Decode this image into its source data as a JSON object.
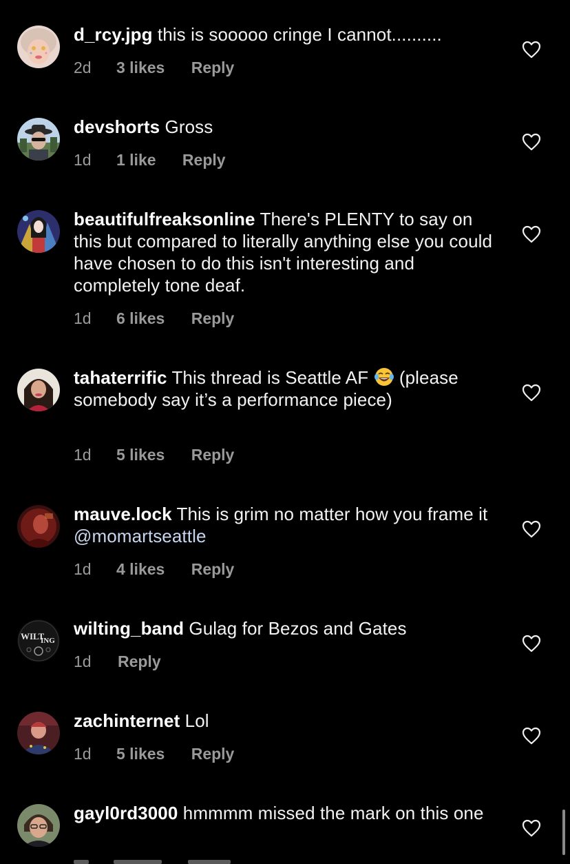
{
  "comments": [
    {
      "username": "d_rcy.jpg",
      "text": "this is sooooo cringe I cannot..........",
      "time": "2d",
      "likes": "3 likes",
      "reply": "Reply"
    },
    {
      "username": "devshorts",
      "text": "Gross",
      "time": "1d",
      "likes": "1 like",
      "reply": "Reply"
    },
    {
      "username": "beautifulfreaksonline",
      "text": "There's PLENTY to say on this but compared to literally anything else you could have chosen to do this isn't interesting and completely tone deaf.",
      "time": "1d",
      "likes": "6 likes",
      "reply": "Reply"
    },
    {
      "username": "tahaterrific",
      "text_before_emoji": "This thread is Seattle AF",
      "text_after_emoji": "(please somebody say it’s a performance piece)",
      "time": "1d",
      "likes": "5 likes",
      "reply": "Reply"
    },
    {
      "username": "mauve.lock",
      "text": "This is grim no matter how you frame it",
      "mention": "@momartseattle",
      "time": "1d",
      "likes": "4 likes",
      "reply": "Reply"
    },
    {
      "username": "wilting_band",
      "text": "Gulag for Bezos and Gates",
      "time": "1d",
      "reply": "Reply",
      "avatar_text_1": "WILT",
      "avatar_text_2": "ING"
    },
    {
      "username": "zachinternet",
      "text": "Lol",
      "time": "1d",
      "likes": "5 likes",
      "reply": "Reply"
    },
    {
      "username": "gayl0rd3000",
      "text": "hmmmm missed the mark on this one"
    }
  ],
  "icons": {
    "like": "heart-outline-icon",
    "emoji": "face-with-tears-of-joy"
  },
  "colors": {
    "background": "#000000",
    "username": "#ffffff",
    "meta": "#9a9a9a",
    "mention": "#c7d6ee"
  }
}
